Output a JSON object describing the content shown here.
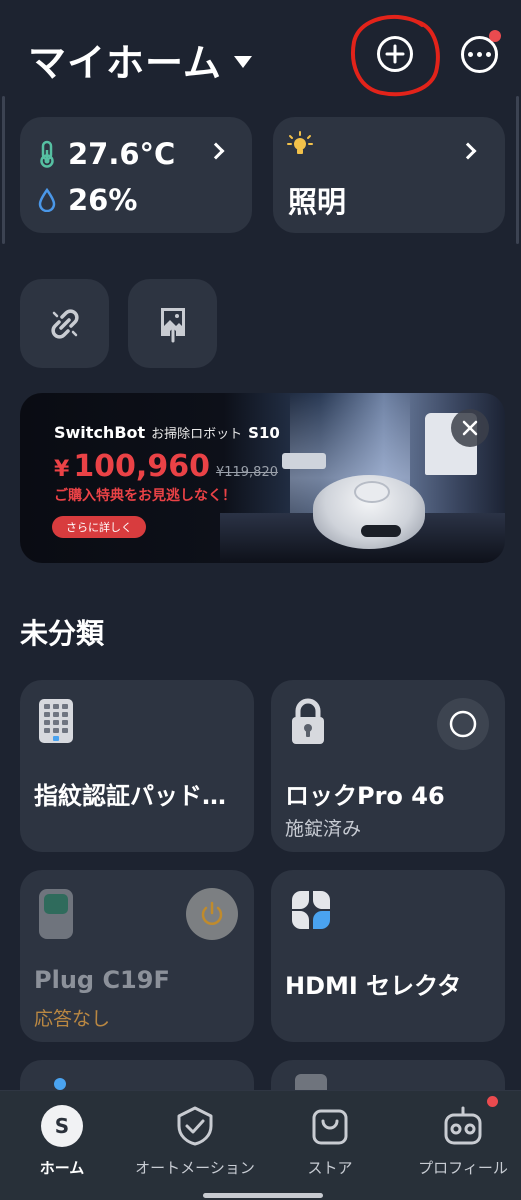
{
  "header": {
    "home_title": "マイホーム",
    "add_icon": "plus-circle-icon",
    "more_icon": "more-horizontal-icon"
  },
  "climate": {
    "temperature": "27.6°C",
    "humidity": "26%"
  },
  "lighting": {
    "label": "照明"
  },
  "banner": {
    "brand": "SwitchBot",
    "product": "お掃除ロボット",
    "model": "S10",
    "currency": "¥",
    "price": "100,960",
    "old_price": "¥119,820",
    "promo": "ご購入特典をお見逃しなく！",
    "cta": "さらに詳しく"
  },
  "section": {
    "title": "未分類"
  },
  "devices": [
    {
      "name": "指紋認証パッド…",
      "status": "",
      "icon": "keypad-icon"
    },
    {
      "name": "ロックPro 46",
      "status": "施錠済み",
      "icon": "padlock-icon"
    },
    {
      "name": "Plug C19F",
      "status": "応答なし",
      "icon": "plug-icon"
    },
    {
      "name": "HDMI セレクタ",
      "status": "",
      "icon": "grid-petals-icon"
    }
  ],
  "nav": [
    {
      "label": "ホーム",
      "icon": "home-s-icon",
      "active": true
    },
    {
      "label": "オートメーション",
      "icon": "shield-check-icon",
      "active": false
    },
    {
      "label": "ストア",
      "icon": "shopping-bag-icon",
      "active": false
    },
    {
      "label": "プロフィール",
      "icon": "robot-face-icon",
      "active": false
    }
  ],
  "colors": {
    "background": "#1d2330",
    "card": "#2d3441",
    "accent_red": "#ea4b4f",
    "offline_orange": "#b98742"
  }
}
